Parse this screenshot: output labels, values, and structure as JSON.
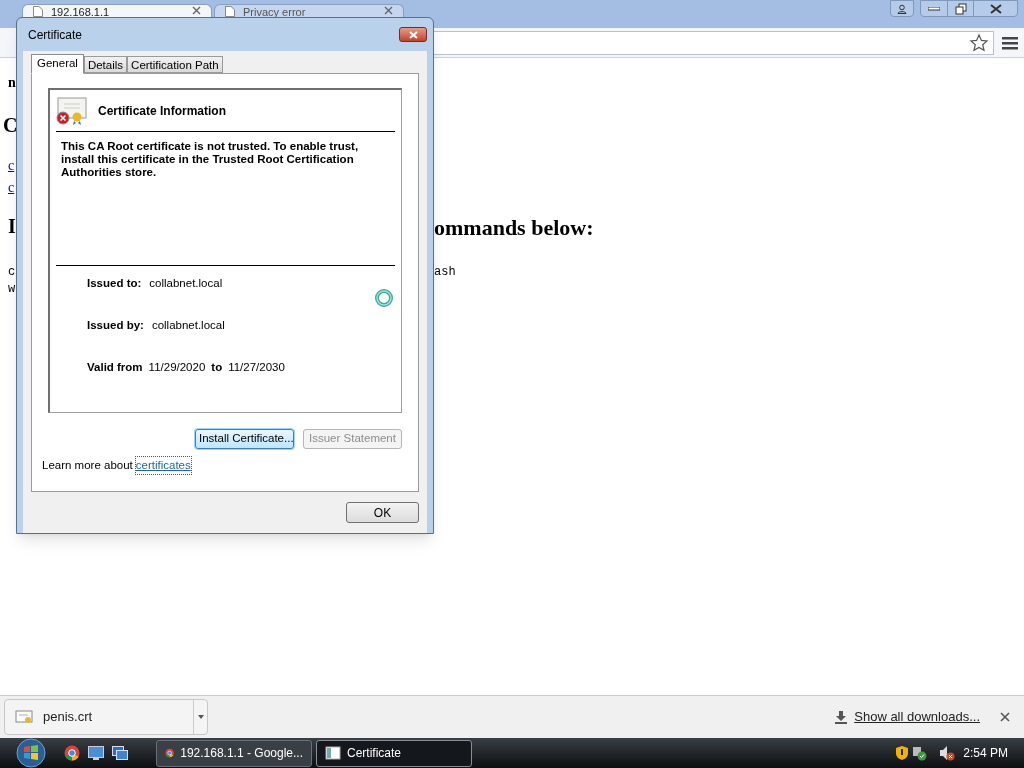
{
  "browser": {
    "tabs": [
      {
        "label": "192.168.1.1",
        "selected": true
      },
      {
        "label": "Privacy error",
        "selected": false
      }
    ]
  },
  "page": {
    "fragments": [
      {
        "kind": "bold",
        "text": "n"
      },
      {
        "kind": "heading",
        "text": "C"
      },
      {
        "kind": "link",
        "text": "c"
      },
      {
        "kind": "link",
        "text": "c"
      },
      {
        "kind": "heading",
        "text": "I"
      },
      {
        "kind": "heading_right",
        "text": "ommands below:"
      },
      {
        "kind": "mono",
        "text": "c"
      },
      {
        "kind": "mono_right",
        "text": "ash"
      },
      {
        "kind": "mono",
        "text": "w"
      }
    ]
  },
  "dialog": {
    "title": "Certificate",
    "tabs": [
      {
        "label": "General",
        "selected": true
      },
      {
        "label": "Details",
        "selected": false
      },
      {
        "label": "Certification Path",
        "selected": false
      }
    ],
    "heading": "Certificate Information",
    "warning": "This CA Root certificate is not trusted. To enable trust, install this certificate in the Trusted Root Certification Authorities store.",
    "issued_to_label": "Issued to:",
    "issued_to": "collabnet.local",
    "issued_by_label": "Issued by:",
    "issued_by": "collabnet.local",
    "valid_from_label": "Valid from",
    "valid_from": "11/29/2020",
    "to_label": "to",
    "valid_to": "11/27/2030",
    "buttons": [
      {
        "label": "Install Certificate...",
        "disabled": false
      },
      {
        "label": "Issuer Statement",
        "disabled": true
      }
    ],
    "learn_more": "Learn more about",
    "learn_more_link": "certificates",
    "ok": "OK"
  },
  "downloads": {
    "file": "penis.crt",
    "show_all": "Show all downloads..."
  },
  "taskbar": {
    "items": [
      {
        "label": "192.168.1.1 - Google...",
        "selected": false
      },
      {
        "label": "Certificate",
        "selected": true
      }
    ],
    "clock": "2:54 PM"
  }
}
